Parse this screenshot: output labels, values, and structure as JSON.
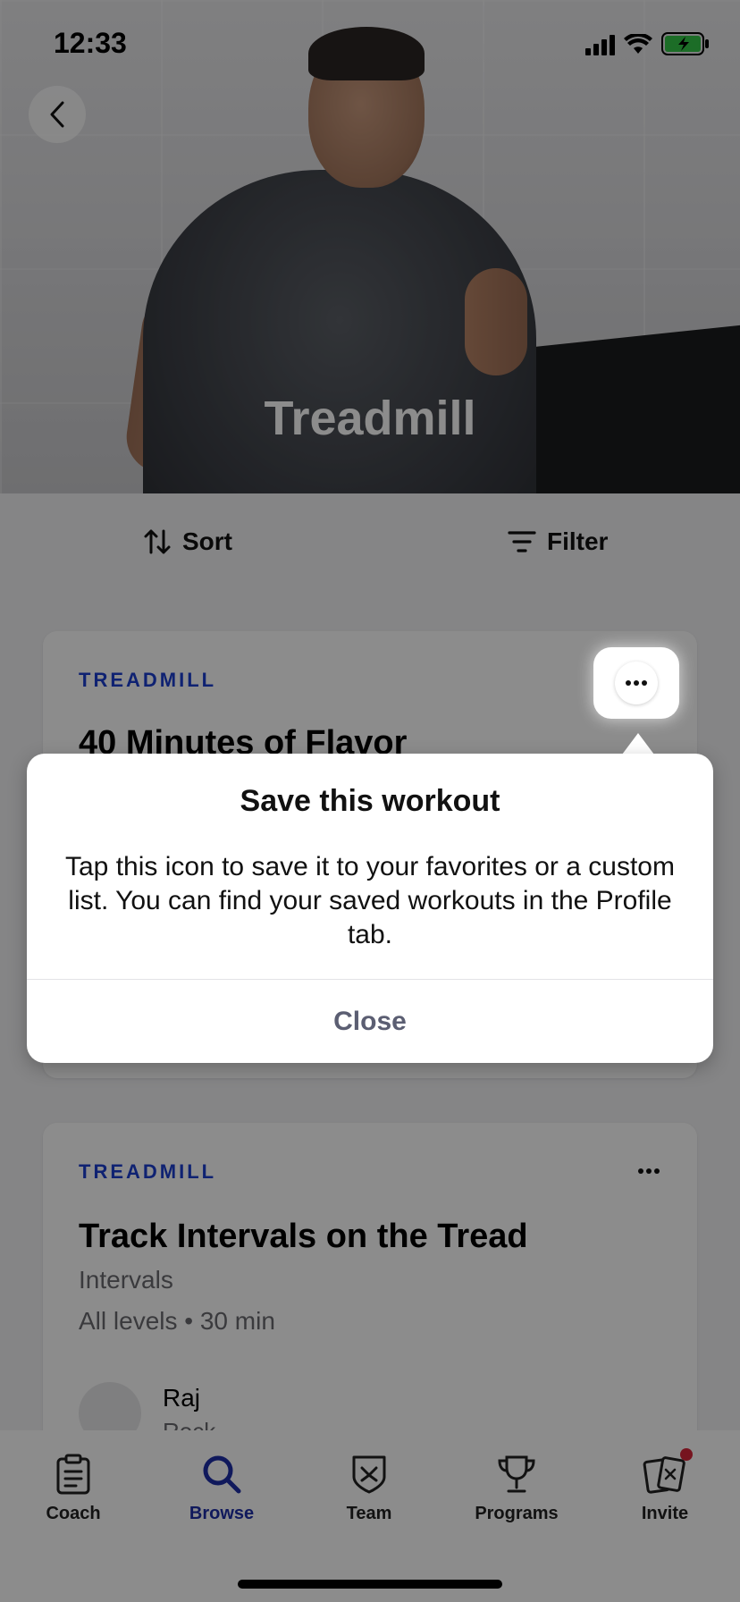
{
  "status_bar": {
    "time": "12:33"
  },
  "hero": {
    "title": "Treadmill"
  },
  "controls": {
    "sort_label": "Sort",
    "filter_label": "Filter"
  },
  "workouts": [
    {
      "tag": "TREADMILL",
      "title": "40 Minutes of Flavor"
    },
    {
      "tag": "TREADMILL",
      "title": "Track Intervals on the Tread",
      "category": "Intervals",
      "meta": "All levels • 30 min",
      "coach_name": "Raj",
      "coach_genre": "Rock"
    }
  ],
  "tooltip": {
    "title": "Save this workout",
    "body": "Tap this icon to save it to your favorites or a custom list. You can find your saved workouts in the Profile tab.",
    "close_label": "Close"
  },
  "tabbar": {
    "tabs": [
      {
        "label": "Coach",
        "icon": "clipboard-icon"
      },
      {
        "label": "Browse",
        "icon": "search-icon",
        "active": true
      },
      {
        "label": "Team",
        "icon": "shield-icon"
      },
      {
        "label": "Programs",
        "icon": "trophy-icon"
      },
      {
        "label": "Invite",
        "icon": "invite-cards-icon",
        "badge": true
      }
    ]
  },
  "colors": {
    "accent": "#1e2fa8",
    "tag": "#1c3fd0",
    "badge": "#d8263a"
  }
}
